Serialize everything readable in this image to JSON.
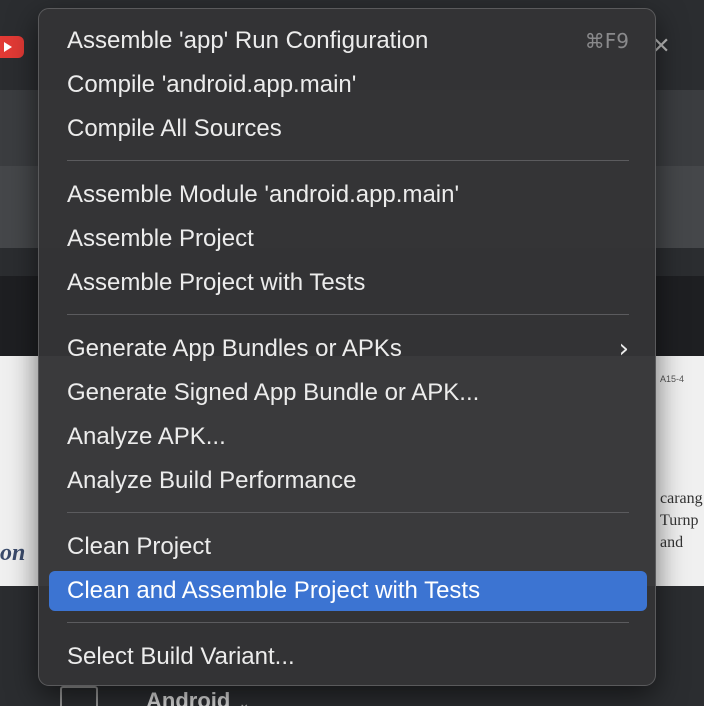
{
  "menu": {
    "items": [
      {
        "label": "Assemble 'app' Run Configuration",
        "shortcut": "⌘F9"
      },
      {
        "label": "Compile 'android.app.main'"
      },
      {
        "label": "Compile All Sources"
      },
      {
        "label": "Assemble Module 'android.app.main'"
      },
      {
        "label": "Assemble Project"
      },
      {
        "label": "Assemble Project with Tests"
      },
      {
        "label": "Generate App Bundles or APKs",
        "submenu_icon": "chevron-right-icon"
      },
      {
        "label": "Generate Signed App Bundle or APK..."
      },
      {
        "label": "Analyze APK..."
      },
      {
        "label": "Analyze Build Performance"
      },
      {
        "label": "Clean Project"
      },
      {
        "label": "Clean and Assemble Project with Tests",
        "highlighted": true
      },
      {
        "label": "Select Build Variant..."
      }
    ]
  },
  "background": {
    "tool_window_dropdown": "Android",
    "document_text_left": "on",
    "document_text_right": "carang\nTurnp\nand"
  },
  "colors": {
    "menu_background": "#343436",
    "highlight": "#3c74d2",
    "text": "#ececec"
  }
}
